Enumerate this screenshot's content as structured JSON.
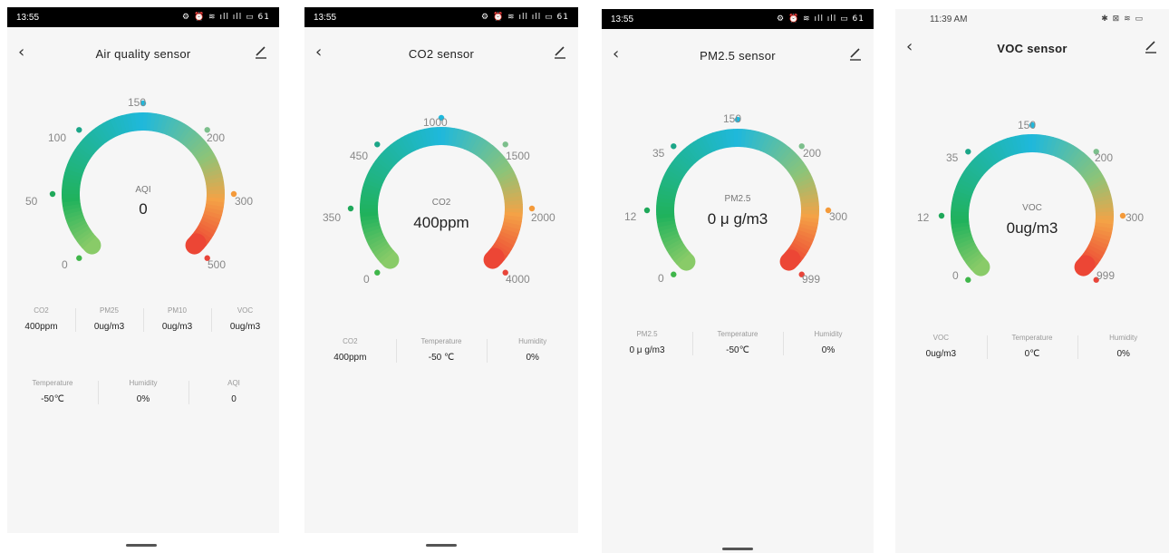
{
  "accent": "#1fb8dc",
  "screens": [
    {
      "time": "13:55",
      "status_icons": "⚙ ⏰ ≋ ıll ıll ▭ 61",
      "title": "Air quality sensor",
      "gauge_label": "AQI",
      "gauge_value": "0",
      "ticks": [
        "0",
        "50",
        "100",
        "150",
        "200",
        "300",
        "500"
      ],
      "info_rows": [
        [
          {
            "label": "CO2",
            "value": "400ppm"
          },
          {
            "label": "PM25",
            "value": "0ug/m3"
          },
          {
            "label": "PM10",
            "value": "0ug/m3"
          },
          {
            "label": "VOC",
            "value": "0ug/m3"
          }
        ],
        [
          {
            "label": "Temperature",
            "value": "-50℃"
          },
          {
            "label": "Humidity",
            "value": "0%"
          },
          {
            "label": "AQI",
            "value": "0"
          }
        ]
      ]
    },
    {
      "time": "13:55",
      "status_icons": "⚙ ⏰ ≋ ıll ıll ▭ 61",
      "title": "CO2 sensor",
      "gauge_label": "CO2",
      "gauge_value": "400ppm",
      "ticks": [
        "0",
        "350",
        "450",
        "1000",
        "1500",
        "2000",
        "4000"
      ],
      "info_rows": [
        [
          {
            "label": "CO2",
            "value": "400ppm"
          },
          {
            "label": "Temperature",
            "value": "-50 ℃"
          },
          {
            "label": "Humidity",
            "value": "0%"
          }
        ]
      ]
    },
    {
      "time": "13:55",
      "status_icons": "⚙ ⏰ ≋ ıll ıll ▭ 61",
      "title": "PM2.5 sensor",
      "gauge_label": "PM2.5",
      "gauge_value": "0 μ g/m3",
      "ticks": [
        "0",
        "12",
        "35",
        "150",
        "200",
        "300",
        "999"
      ],
      "info_rows": [
        [
          {
            "label": "PM2.5",
            "value": "0 μ g/m3"
          },
          {
            "label": "Temperature",
            "value": "-50℃"
          },
          {
            "label": "Humidity",
            "value": "0%"
          }
        ]
      ]
    },
    {
      "time": "11:39 AM",
      "status_icons": "✱ ⊠ ≋ ▭",
      "title": "VOC sensor",
      "gauge_label": "VOC",
      "gauge_value": "0ug/m3",
      "ticks": [
        "0",
        "12",
        "35",
        "150",
        "200",
        "300",
        "999"
      ],
      "info_rows": [
        [
          {
            "label": "VOC",
            "value": "0ug/m3"
          },
          {
            "label": "Temperature",
            "value": "0℃"
          },
          {
            "label": "Humidity",
            "value": "0%"
          }
        ]
      ]
    }
  ]
}
